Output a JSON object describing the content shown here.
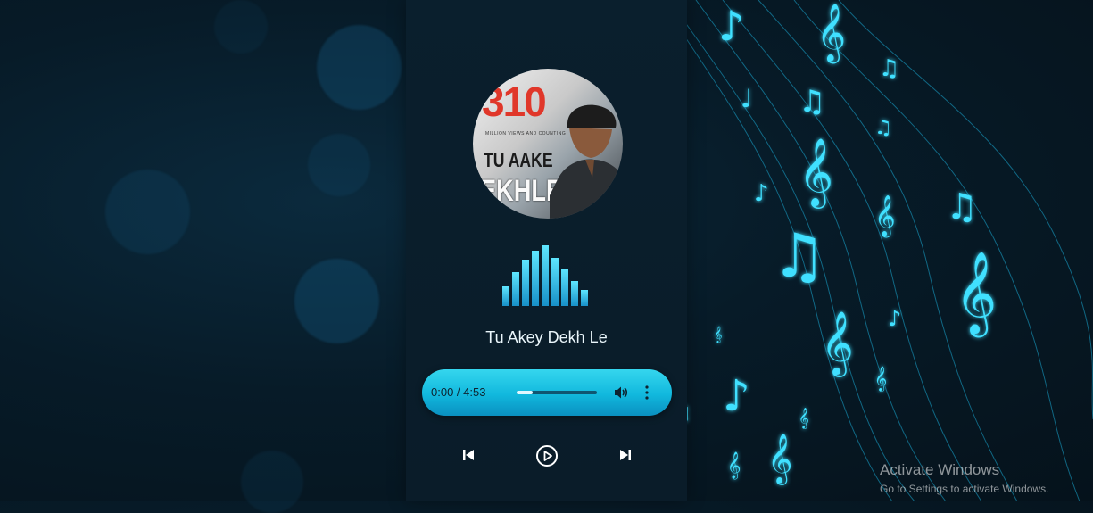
{
  "player": {
    "cover": {
      "number": "310",
      "small_text": "MILLION VIEWS AND COUNTING",
      "line1": "TU AAKE",
      "line2": "EKHLE"
    },
    "song_title": "Tu Akey Dekh Le",
    "audio": {
      "time_display": "0:00  / 4:53",
      "progress": 0.2
    },
    "controls": {
      "previous": "skip-previous-icon",
      "play": "play-circle-icon",
      "next": "skip-next-icon"
    }
  },
  "watermark": {
    "line1": "Activate Windows",
    "line2": "Go to Settings to activate Windows."
  },
  "colors": {
    "accent": "#1fc6e8",
    "note_glow": "#3fe0ff",
    "background": "#071b28"
  }
}
